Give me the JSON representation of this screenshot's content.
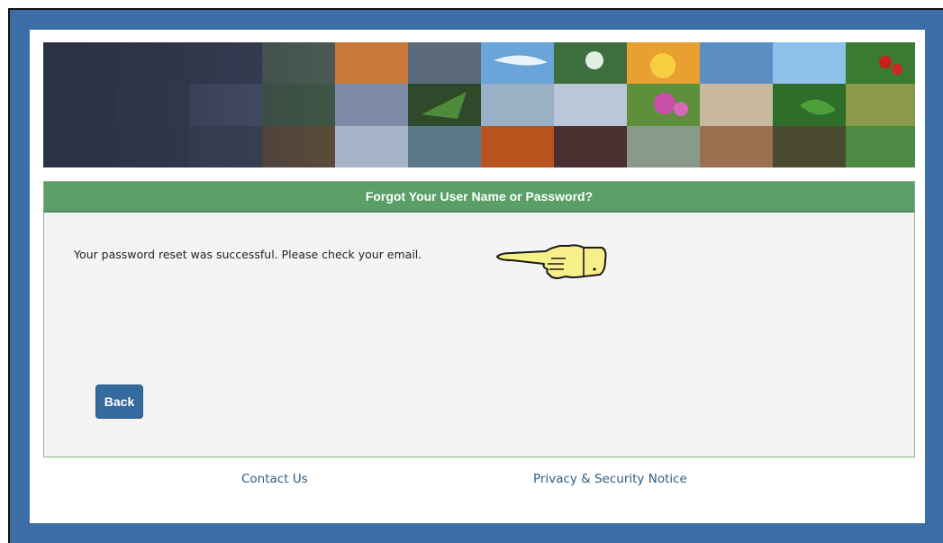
{
  "banner": {
    "image_name": "nature-photo-mosaic-banner",
    "colors": {
      "dark_base": "#2e3548"
    }
  },
  "panel": {
    "title": "Forgot Your User Name or Password?",
    "message": "Your password reset was successful. Please check your email.",
    "annotation_icon": "pointing-hand-icon",
    "back_label": "Back"
  },
  "footer": {
    "contact_label": "Contact Us",
    "privacy_label": "Privacy & Security Notice"
  },
  "theme": {
    "frame_blue": "#3c6da6",
    "header_green": "#5b9e68",
    "button_blue": "#356a9e",
    "link_blue": "#2d5d86"
  }
}
